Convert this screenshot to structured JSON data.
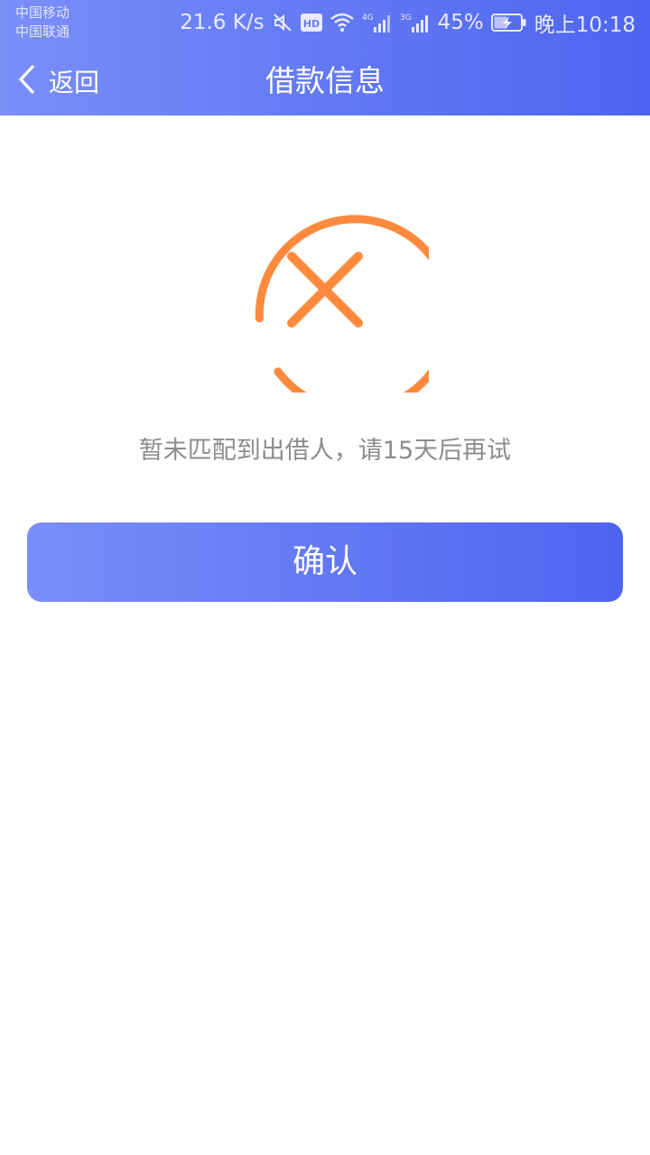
{
  "status_bar": {
    "carrier_1": "中国移动",
    "carrier_2": "中国联通",
    "network_speed": "21.6 K/s",
    "hd_badge": "HD",
    "signal_1_type": "4G",
    "signal_2_type": "3G",
    "battery_percent": "45%",
    "time": "晚上10:18",
    "icons": [
      "mute-icon",
      "hd-icon",
      "wifi-icon",
      "signal-4g-icon",
      "signal-3g-icon",
      "battery-charging-icon"
    ]
  },
  "nav": {
    "back_label": "返回",
    "title": "借款信息",
    "back_icon": "chevron-left-icon"
  },
  "result": {
    "icon": "failure-x-circle-icon",
    "message": "暂未匹配到出借人，请15天后再试"
  },
  "actions": {
    "confirm_label": "确认"
  },
  "colors": {
    "header_gradient_start": "#7a8ff8",
    "header_gradient_end": "#4d64f0",
    "error_orange": "#ff8a3d",
    "message_gray": "#8c8c8c"
  }
}
